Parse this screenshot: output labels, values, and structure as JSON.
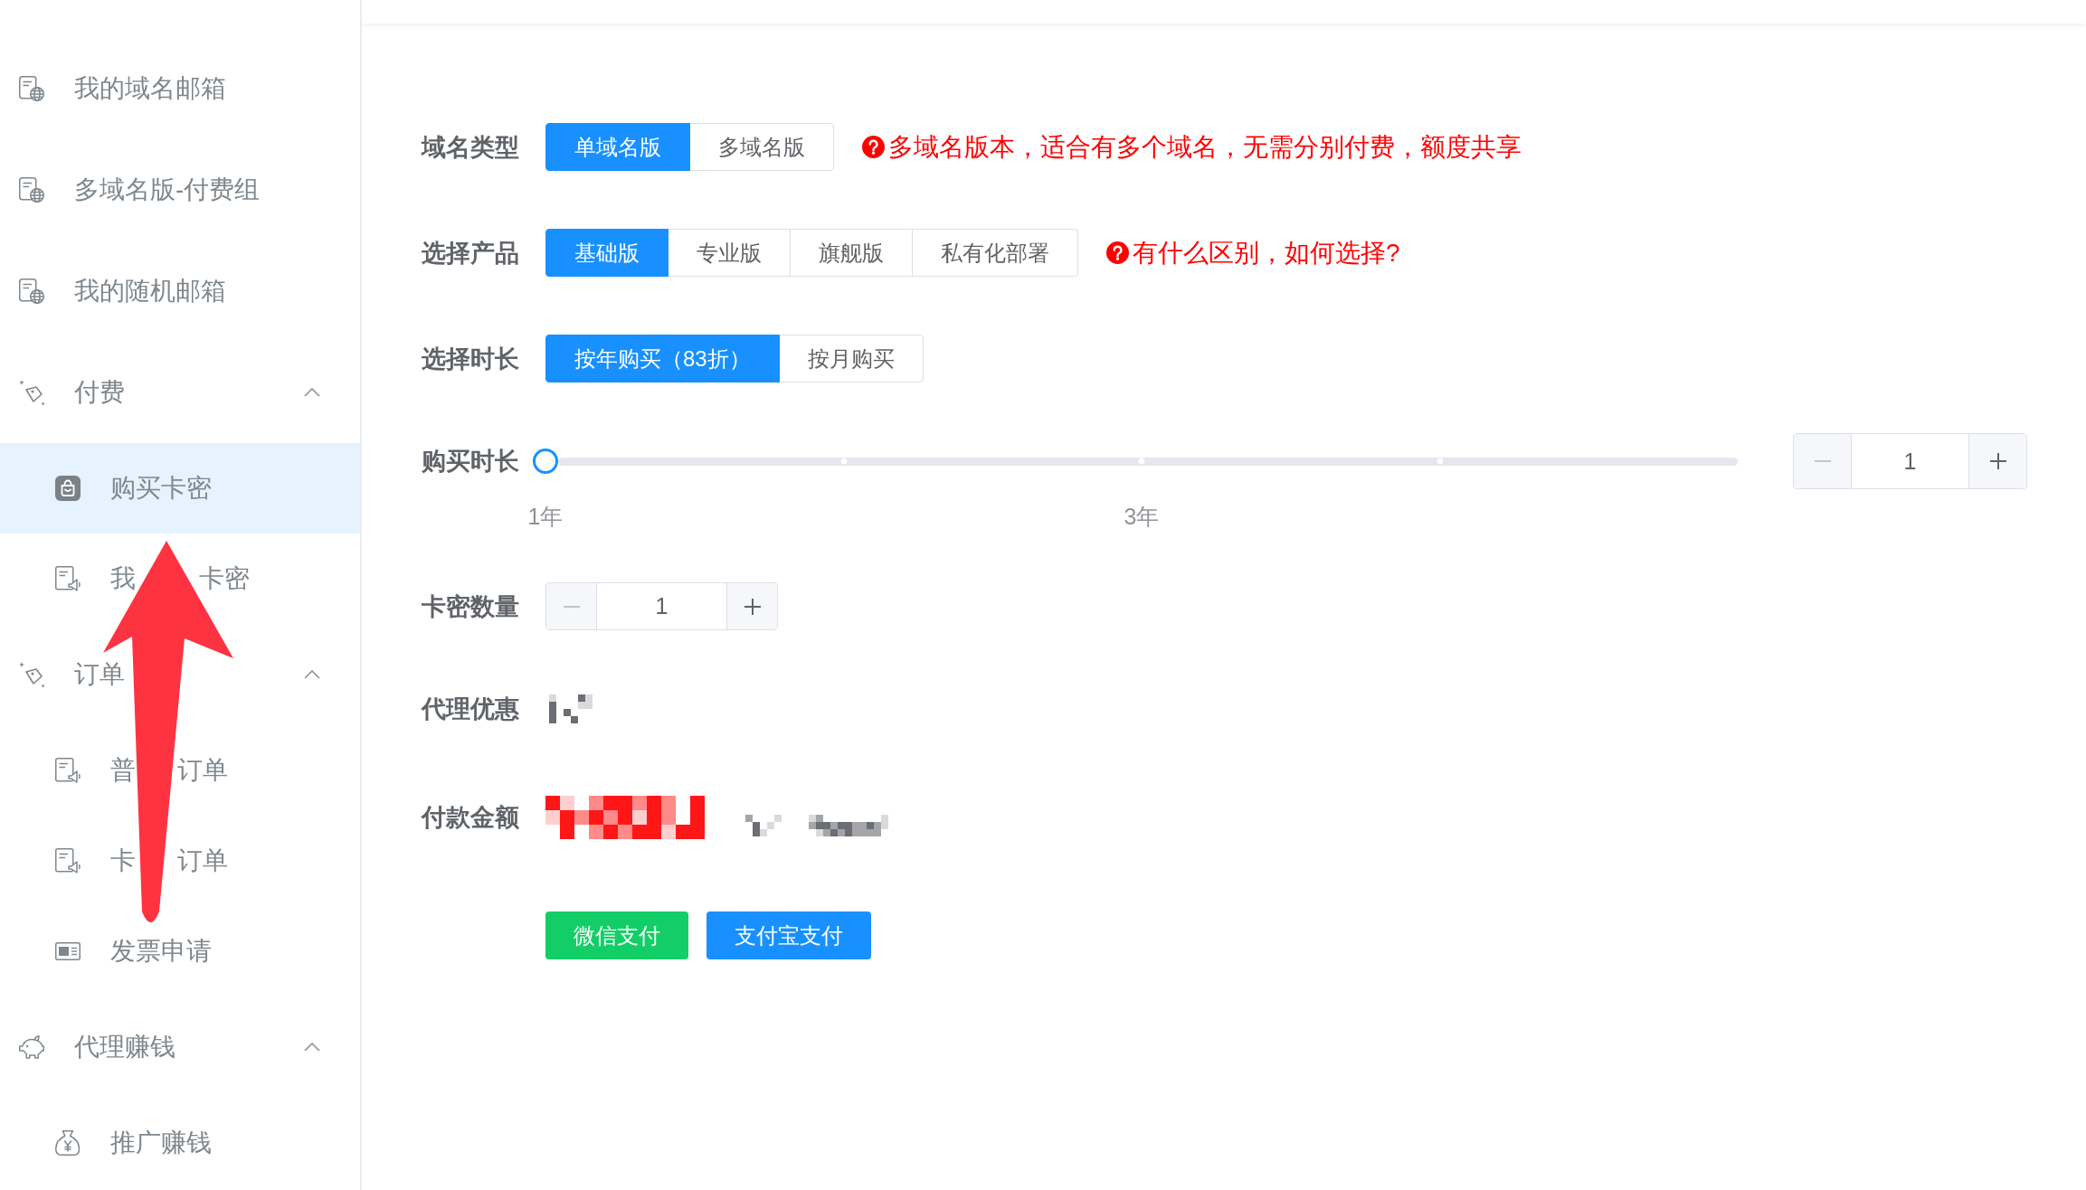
{
  "sidebar": {
    "items": [
      {
        "kind": "link",
        "label": "我的域名邮箱",
        "selected": false
      },
      {
        "kind": "link",
        "label": "多域名版-付费组",
        "selected": false
      },
      {
        "kind": "link",
        "label": "我的随机邮箱",
        "selected": false
      },
      {
        "kind": "group",
        "label": "付费",
        "expanded": true,
        "children": [
          {
            "label": "购买卡密",
            "selected": true
          },
          {
            "label_parts": [
              "我",
              "卡密"
            ],
            "selected": false
          }
        ]
      },
      {
        "kind": "group",
        "label": "订单",
        "expanded": true,
        "children": [
          {
            "label_parts": [
              "普",
              "订单"
            ],
            "selected": false
          },
          {
            "label_parts": [
              "卡",
              "订单"
            ],
            "selected": false
          },
          {
            "label": "发票申请",
            "selected": false
          }
        ]
      },
      {
        "kind": "group",
        "label": "代理赚钱",
        "expanded": true,
        "children": [
          {
            "label": "推广赚钱",
            "selected": false
          }
        ]
      }
    ]
  },
  "form": {
    "rows": [
      {
        "kind": "options",
        "label": "域名类型",
        "options": [
          {
            "label": "单域名版",
            "selected": true
          },
          {
            "label": "多域名版",
            "selected": false
          }
        ],
        "note": "多域名版本，适合有多个域名，无需分别付费，额度共享"
      },
      {
        "kind": "options",
        "label": "选择产品",
        "options": [
          {
            "label": "基础版",
            "selected": true
          },
          {
            "label": "专业版",
            "selected": false
          },
          {
            "label": "旗舰版",
            "selected": false
          },
          {
            "label": "私有化部署",
            "selected": false
          }
        ],
        "note": "有什么区别，如何选择?"
      },
      {
        "kind": "options",
        "label": "选择时长",
        "options": [
          {
            "label": "按年购买（83折）",
            "selected": true
          },
          {
            "label": "按月购买",
            "selected": false
          }
        ]
      },
      {
        "kind": "slider",
        "label": "购买时长",
        "level": 0,
        "marks": [
          "1年",
          "3年"
        ],
        "stepper": {
          "value": "1",
          "decrease_disabled": true,
          "increase_disabled": false
        }
      },
      {
        "kind": "stepper",
        "label": "卡密数量",
        "stepper": {
          "value": "1",
          "decrease_disabled": true,
          "increase_disabled": false
        }
      },
      {
        "kind": "masked",
        "label": "代理优惠"
      },
      {
        "kind": "maskedprice",
        "label": "付款金额"
      }
    ],
    "actions": [
      {
        "kind": "success",
        "label": "微信支付"
      },
      {
        "kind": "primary",
        "label": "支付宝支付"
      }
    ]
  }
}
